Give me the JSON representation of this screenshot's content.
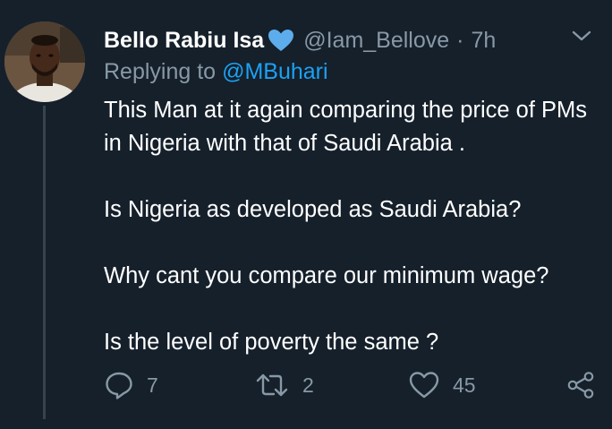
{
  "tweet": {
    "author": {
      "display_name": "Bello Rabiu Isa",
      "badge_icon": "blue-heart-emoji",
      "handle": "@Iam_Bellove",
      "separator": "·",
      "time": "7h"
    },
    "replying_to": {
      "prefix": "Replying to",
      "mention": "@MBuhari"
    },
    "body": [
      "This Man at it again comparing the price of PMs in Nigeria with that of Saudi Arabia .",
      "Is Nigeria as developed as Saudi Arabia?",
      "Why cant you compare our minimum wage?",
      "Is the level of poverty the same ?"
    ],
    "actions": {
      "reply_count": "7",
      "retweet_count": "2",
      "like_count": "45"
    }
  },
  "colors": {
    "background": "#15202b",
    "text_primary": "#ffffff",
    "text_secondary": "#8899a6",
    "accent": "#1da1f2",
    "thread_line": "#38444d",
    "badge_heart": "#5dadec"
  }
}
